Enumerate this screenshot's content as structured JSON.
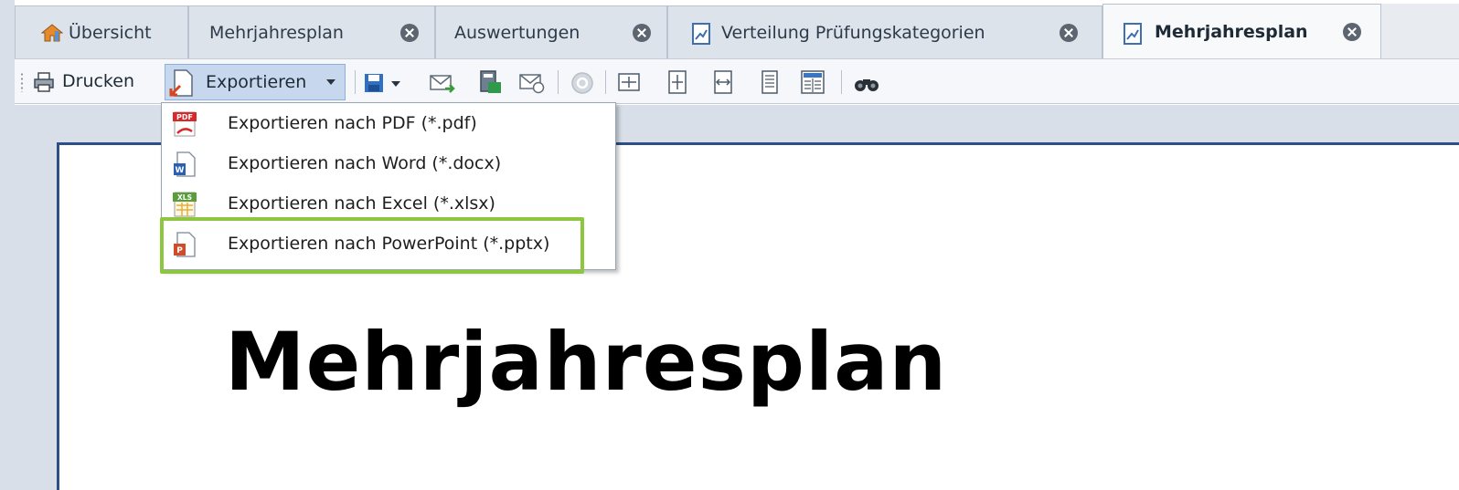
{
  "tabs": [
    {
      "label": "Übersicht",
      "icon": "home-icon",
      "closable": false,
      "active": false
    },
    {
      "label": "Mehrjahresplan",
      "closable": true,
      "active": false
    },
    {
      "label": "Auswertungen",
      "closable": true,
      "active": false
    },
    {
      "label": "Verteilung Prüfungskategorien",
      "icon": "report-icon",
      "closable": true,
      "active": false
    },
    {
      "label": "Mehrjahresplan",
      "icon": "report-icon",
      "closable": true,
      "active": true
    }
  ],
  "toolbar": {
    "print_label": "Drucken",
    "export_label": "Exportieren"
  },
  "export_menu": {
    "items": [
      {
        "label": "Exportieren nach PDF (*.pdf)",
        "icon": "pdf-icon",
        "icon_text": "PDF"
      },
      {
        "label": "Exportieren nach Word (*.docx)",
        "icon": "word-icon",
        "icon_text": "W"
      },
      {
        "label": "Exportieren nach Excel (*.xlsx)",
        "icon": "excel-icon",
        "icon_text": "XLS"
      },
      {
        "label": "Exportieren nach PowerPoint (*.pptx)",
        "icon": "powerpoint-icon",
        "icon_text": "P",
        "highlighted": true
      }
    ]
  },
  "report": {
    "title": "Mehrjahresplan"
  },
  "colors": {
    "highlight_border": "#8dc63f",
    "page_border": "#2b4f86",
    "pressed_button": "#c7d8ee"
  }
}
